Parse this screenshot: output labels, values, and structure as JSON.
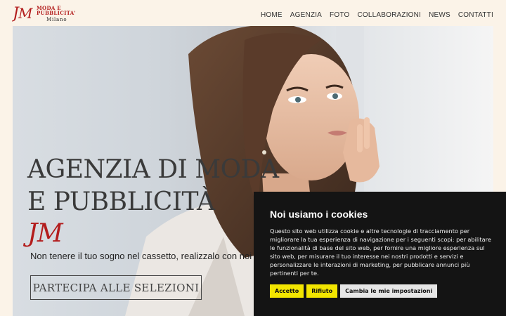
{
  "brand": {
    "line1": "MODA E",
    "line2": "PUBBLICITA'",
    "city": "Milano",
    "mark": "JM"
  },
  "nav": {
    "items": [
      "HOME",
      "AGENZIA",
      "FOTO",
      "COLLABORAZIONI",
      "NEWS",
      "CONTATTI"
    ]
  },
  "hero": {
    "headline_line1": "AGENZIA DI MODA",
    "headline_line2": "E PUBBLICITÀ",
    "headline_jm": "JM",
    "subtitle": "Non tenere il tuo sogno nel cassetto, realizzalo con noi",
    "cta_label": "PARTECIPA ALLE SELEZIONI"
  },
  "cookie": {
    "title": "Noi usiamo i cookies",
    "text": "Questo sito web utilizza cookie e altre tecnologie di tracciamento per migliorare la tua esperienza di navigazione per i seguenti scopi: per abilitare le funzionalità di base del sito web, per fornire una migliore esperienza sul sito web, per misurare il tuo interesse nei nostri prodotti e servizi e personalizzare le interazioni di marketing, per pubblicare annunci più pertinenti per te.",
    "accept_label": "Accetto",
    "reject_label": "Rifiuto",
    "settings_label": "Cambia le mie impostazioni"
  },
  "colors": {
    "accent": "#b31d1d",
    "cookie_bg": "#141414",
    "cookie_button": "#f2e500"
  }
}
